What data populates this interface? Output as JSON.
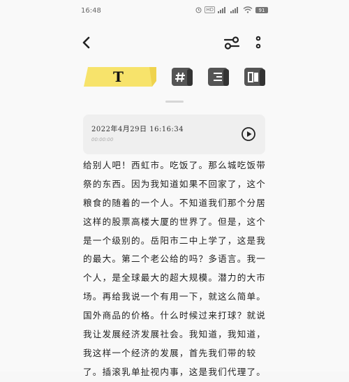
{
  "status_bar": {
    "time": "16:48",
    "battery": "91"
  },
  "nav": {
    "back_icon": "chevron-left-icon",
    "settings_icon": "sliders-icon",
    "more_icon": "more-vertical-icon"
  },
  "toolbar": {
    "text_tool_label": "T",
    "accent_color": "#f7e36b"
  },
  "recording": {
    "datetime": "2022年4月29日 16:16:34",
    "duration": "00:00:00"
  },
  "note": {
    "lines": [
      "给别人吧！西虹市。吃饭了。那么城吃饭带",
      "祭的东西。因为我知道如果不回家了，这个",
      "粮食的随着的一个人。不知道我们那个分居",
      "这样的股票高楼大厦的世界了。但是，这个",
      "是一个级别的。岳阳市二中上学了，这是我",
      "的最大。第二个老公给的吗？多语言。我一",
      "个人，是全球最大的超大规模。潜力的大市",
      "场。再给我说一个有用一下，就这么简单。",
      "国外商品的价格。什么时候过来打球？就说",
      "我让发展经济发展社会。我知道，我知道，",
      "我这样一个经济的发展，首先我们带的较",
      "了。插滚乳单扯视内事，这是我们代理了。"
    ]
  }
}
